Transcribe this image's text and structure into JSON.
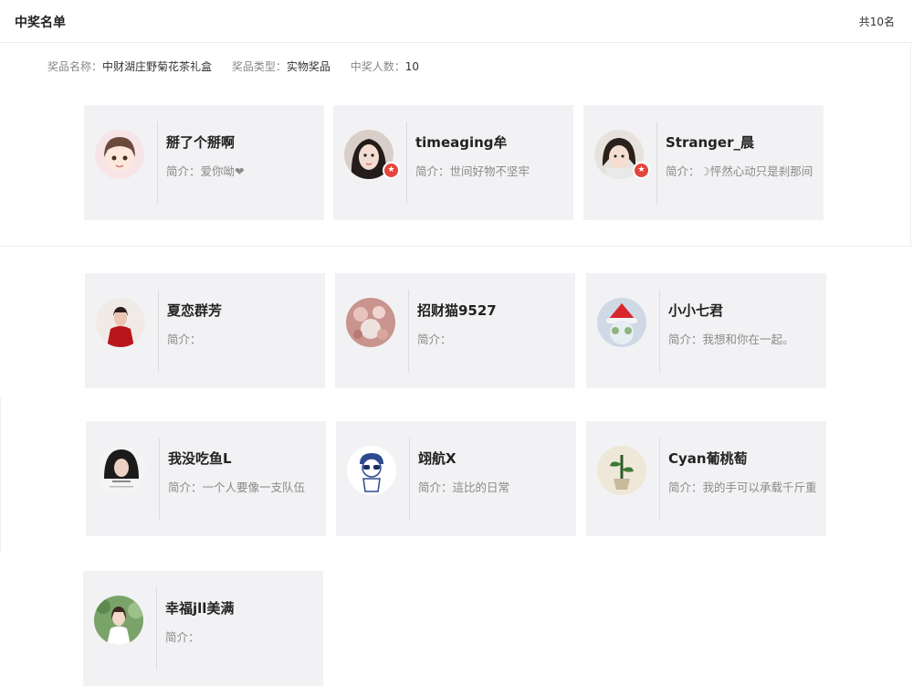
{
  "header": {
    "title": "中奖名单",
    "total": "共10名"
  },
  "prize": {
    "name_label": "奖品名称：",
    "name_value": "中财湖庄野菊花茶礼盒",
    "type_label": "奖品类型：",
    "type_value": "实物奖品",
    "count_label": "中奖人数：",
    "count_value": "10"
  },
  "winners": [
    {
      "name": "掰了个掰啊",
      "intro": "简介：爱你呦❤",
      "badge": false,
      "avatar": "cartoon-girl-avatar"
    },
    {
      "name": "timeaging牟",
      "intro": "简介：世间好物不坚牢",
      "badge": true,
      "avatar": "woman-selfie-avatar"
    },
    {
      "name": "Stranger_晨",
      "intro": "简介：☽怦然心动只是刹那间",
      "badge": true,
      "avatar": "girl-photo-avatar"
    },
    {
      "name": "夏恋群芳",
      "intro": "简介：",
      "badge": false,
      "avatar": "woman-red-dress-avatar"
    },
    {
      "name": "招财猫9527",
      "intro": "简介：",
      "badge": false,
      "avatar": "pink-floral-avatar"
    },
    {
      "name": "小小七君",
      "intro": "简介：我想和你在一起。",
      "badge": false,
      "avatar": "christmas-hat-avatar"
    },
    {
      "name": "我没吃鱼L",
      "intro": "简介：一个人要像一支队伍",
      "badge": false,
      "avatar": "dark-hair-girl-avatar"
    },
    {
      "name": "翊航X",
      "intro": "简介：這比的日常",
      "badge": false,
      "avatar": "sketch-boy-avatar"
    },
    {
      "name": "Cyan葡桃萄",
      "intro": "简介：我的手可以承载千斤重",
      "badge": false,
      "avatar": "plant-pot-avatar"
    },
    {
      "name": "幸福jll美满",
      "intro": "简介：",
      "badge": false,
      "avatar": "woman-white-shirt-avatar"
    }
  ],
  "colors": {
    "card_bg": "#f2f2f4",
    "badge": "#e3463c",
    "text_muted": "#8a8a8a"
  }
}
